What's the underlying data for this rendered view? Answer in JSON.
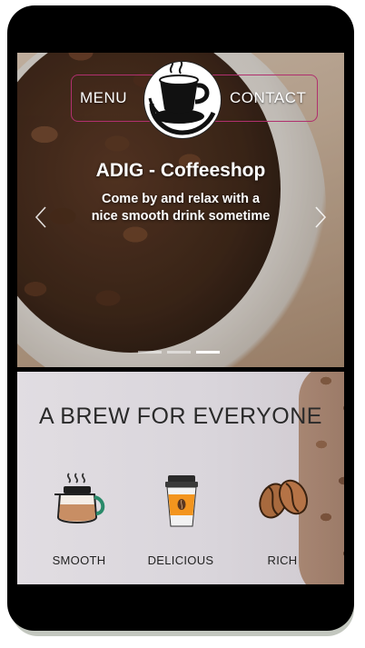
{
  "nav": {
    "menu_label": "MENU",
    "contact_label": "CONTACT"
  },
  "hero": {
    "title": "ADIG - Coffeeshop",
    "subtitle": "Come by and relax with a nice smooth drink sometime",
    "slides_total": 3,
    "active_slide": 3
  },
  "features": {
    "title": "A BREW FOR EVERYONE",
    "items": [
      {
        "label": "SMOOTH",
        "icon": "coffee-pot-icon"
      },
      {
        "label": "DELICIOUS",
        "icon": "takeaway-cup-icon"
      },
      {
        "label": "RICH",
        "icon": "coffee-beans-icon"
      }
    ]
  },
  "colors": {
    "nav_border": "#b0306e",
    "phone_frame": "#000000"
  }
}
